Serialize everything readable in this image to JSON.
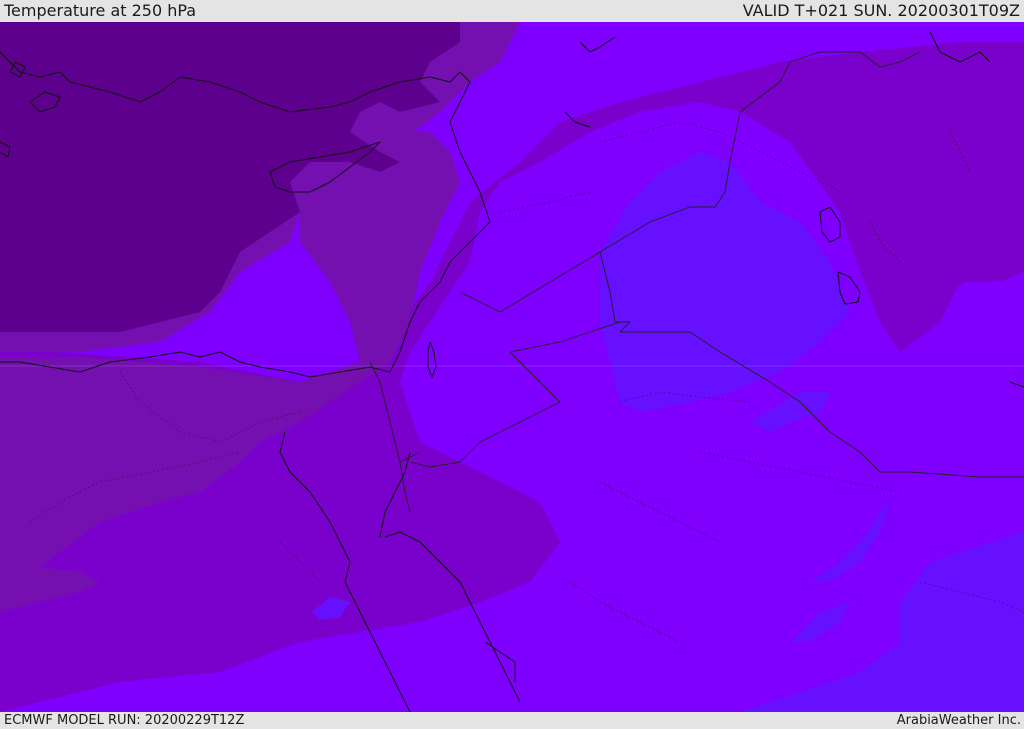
{
  "header": {
    "title": "Temperature at 250 hPa",
    "valid_time": "VALID T+021 SUN. 20200301T09Z"
  },
  "footer": {
    "model_run": "ECMWF MODEL RUN: 20200229T12Z",
    "credit": "ArabiaWeather Inc."
  },
  "map": {
    "colors": {
      "coldest": "#5e008e",
      "cold": "#6a009c",
      "cool": "#7510b0",
      "mid": "#7a00cc",
      "base": "#8000ff",
      "warm": "#6610ff",
      "coastline": "#111111",
      "border": "#222222"
    }
  }
}
